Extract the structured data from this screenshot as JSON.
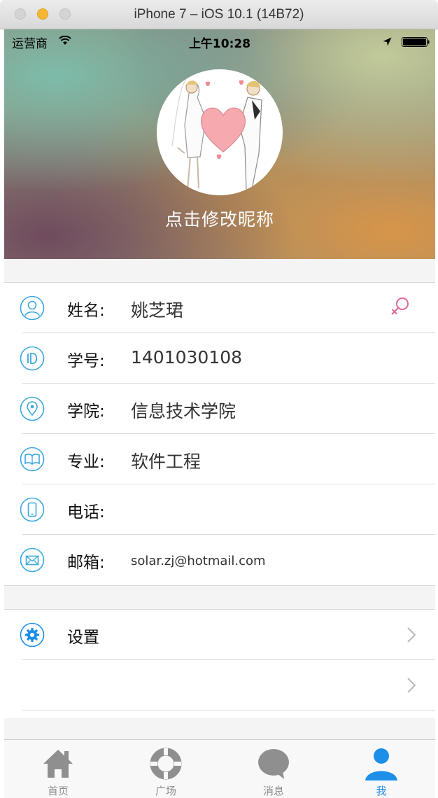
{
  "window": {
    "title": "iPhone 7 – iOS 10.1 (14B72)"
  },
  "status_bar": {
    "carrier": "运营商",
    "time": "上午10:28"
  },
  "profile": {
    "nickname": "点击修改昵称"
  },
  "info_rows": [
    {
      "label": "姓名:",
      "value": "姚芝珺",
      "icon": "user-icon"
    },
    {
      "label": "学号:",
      "value": "1401030108",
      "icon": "id-icon"
    },
    {
      "label": "学院:",
      "value": "信息技术学院",
      "icon": "location-pin-icon"
    },
    {
      "label": "专业:",
      "value": "软件工程",
      "icon": "book-icon"
    },
    {
      "label": "电话:",
      "value": "",
      "icon": "phone-icon"
    },
    {
      "label": "邮箱:",
      "value": "solar.zj@hotmail.com",
      "icon": "mail-icon"
    }
  ],
  "settings_rows": [
    {
      "label": "设置",
      "icon": "gear-icon"
    },
    {
      "label": ""
    }
  ],
  "tabs": [
    {
      "label": "首页",
      "icon": "home-icon"
    },
    {
      "label": "广场",
      "icon": "plaza-icon"
    },
    {
      "label": "消息",
      "icon": "message-icon"
    },
    {
      "label": "我",
      "icon": "me-icon",
      "active": true
    }
  ],
  "colors": {
    "accent": "#1d8fe8",
    "icon_blue": "#3aa7df",
    "female": "#e0679a",
    "tab_inactive": "#8f8f8f"
  }
}
